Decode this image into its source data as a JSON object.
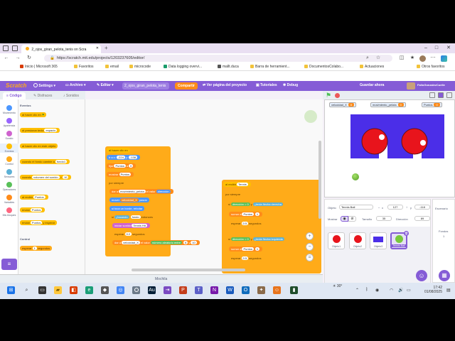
{
  "browser": {
    "tab_title": "2_ojos_giran_pelota_tenis on Scra",
    "new_tab": "+",
    "url": "https://scratch.mit.edu/projects/1203237605/editor/",
    "bookmarks": [
      "Inicio | Microsoft 365",
      "Favoritos",
      "email",
      "microcode",
      "Data logging overvi...",
      "mallt.duca",
      "Barra de herramient...",
      "DocumentosColabo...",
      "Actuaciones"
    ],
    "other_favorites": "Otros favoritos"
  },
  "scratch": {
    "logo": "Scratch",
    "menu": {
      "settings": "Settings",
      "file": "Archivo",
      "edit": "Editar",
      "project_title": "2_ojos_giran_pelota_tenis",
      "share": "Compartir",
      "see_project": "Ver página del proyecto",
      "tutorials": "Tutoriales",
      "debug": "Debug",
      "save_now": "Guardar ahora",
      "user": "FalloGonzalezCuelle"
    },
    "tabs": {
      "code": "Código",
      "costumes": "Disfraces",
      "sounds": "Sonidos"
    },
    "categories": [
      {
        "label": "Movimiento",
        "color": "#4c97ff"
      },
      {
        "label": "Apariencia",
        "color": "#9966ff"
      },
      {
        "label": "Sonido",
        "color": "#cf63cf"
      },
      {
        "label": "Eventos",
        "color": "#ffbf00"
      },
      {
        "label": "Control",
        "color": "#ffab19"
      },
      {
        "label": "Sensores",
        "color": "#5cb1d6"
      },
      {
        "label": "Operadores",
        "color": "#59c059"
      },
      {
        "label": "Variables",
        "color": "#ff8c1a"
      },
      {
        "label": "Mis bloques",
        "color": "#ff6680"
      }
    ],
    "palette": {
      "header_events": "Eventos",
      "b1": "al hacer clic en",
      "b2": "al presionar tecla",
      "b2_arg": "espacio",
      "b3": "al hacer clic en este objeto",
      "b4": "cuando el fondo cambie a",
      "b4_arg": "fondo1",
      "b5": "cuando",
      "b5_mid": "volumen del sonido",
      "b5_op": ">",
      "b5_val": "10",
      "b6": "al recibir",
      "b6_arg": "Puntos",
      "b7": "enviar",
      "b7_arg": "Puntos",
      "b8": "enviar",
      "b8_arg": "Puntos",
      "b8_tail": "y esperar",
      "header_control": "Control",
      "b9": "esperar",
      "b9_val": "1",
      "b9_tail": "segundos"
    },
    "script1": {
      "hat": "al hacer clic en",
      "s1": "ir a x:",
      "s1_x": "-224",
      "s1_y": "-138",
      "s1_mid": "y:",
      "s2": "fijar",
      "s2_var": "Puntos",
      "s2_mid": "a",
      "s2_val": "0",
      "s3": "mostrar",
      "s3_var": "Puntos",
      "s4": "por siempre",
      "s5": "dar a",
      "s5_var": "movimiento_pelota",
      "s5_mid": "el valor",
      "s5_val": "dirección",
      "s6": "mover",
      "s6_var": "velocidad_X",
      "s6_tail": "pasos",
      "s7": "si toca un borde, rebotar",
      "s8": "si",
      "s8_mid": "¿tocando",
      "s8_arg": "fondo",
      "s8_tail": "entonces",
      "s9": "iniciar sonido",
      "s9_arg": "Tennis Hit",
      "s10": "esperar",
      "s10_val": "0.2",
      "s10_tail": "segundos",
      "s11": "dar a",
      "s11_var": "velocidad_X",
      "s11_mid": "el valor",
      "s11_arg": "número aleatorio entre",
      "s11_a": "6",
      "s11_b": "10",
      "s11_mid2": "y"
    },
    "script2": {
      "hat": "al recibir",
      "hat_arg": "Tennis",
      "s1": "por siempre",
      "s2": "si",
      "s2_arg": "dirección",
      "s2_op": "=",
      "s2_val": "0",
      "s2_and": "y",
      "s2_key": "¿tecla",
      "s2_key_arg": "flecha derecha",
      "s3": "sumar a",
      "s3_var": "Puntos",
      "s3_val": "1",
      "s4": "esperar",
      "s4_val": "0.5",
      "s4_tail": "segundos",
      "s5": "si",
      "s5_arg": "dirección",
      "s5_op": "=",
      "s5_val": "0",
      "s5_and": "y",
      "s5_key": "¿tecla",
      "s5_key_arg": "flecha izquierda",
      "s6": "sumar a",
      "s6_var": "Puntos",
      "s6_val": "1",
      "s7": "esperar",
      "s7_val": "0.5",
      "s7_tail": "segundos"
    },
    "backpack": "Mochila",
    "stage": {
      "monitors": [
        {
          "label": "velocidad_X",
          "value": "8"
        },
        {
          "label": "movimiento_pelota",
          "value": "0"
        },
        {
          "label": "Puntos",
          "value": "0"
        }
      ]
    },
    "sprite_info": {
      "sprite_label": "Objeto",
      "sprite_name": "Tennis Ball",
      "x_label": "x",
      "x_value": "127",
      "y_label": "y",
      "y_value": "-118",
      "show_label": "Mostrar",
      "size_label": "Tamaño",
      "size_value": "35",
      "dir_label": "Dirección",
      "dir_value": "89"
    },
    "sprites": [
      "Objeto1",
      "Objeto2",
      "Objeto3",
      "Tennis Ball"
    ],
    "stage_pane": {
      "title": "Escenario",
      "backdrops_label": "Fondos",
      "backdrops_count": "1"
    }
  },
  "taskbar": {
    "weather": "30°",
    "time": "17:42",
    "date": "01/08/2025"
  },
  "colors": {
    "accent": "#855cd6",
    "events": "#ffbf00",
    "control": "#ffab19",
    "stage_blue": "#4b2ee8",
    "eye_red": "#e8141c",
    "ball_green": "#78c83c"
  }
}
